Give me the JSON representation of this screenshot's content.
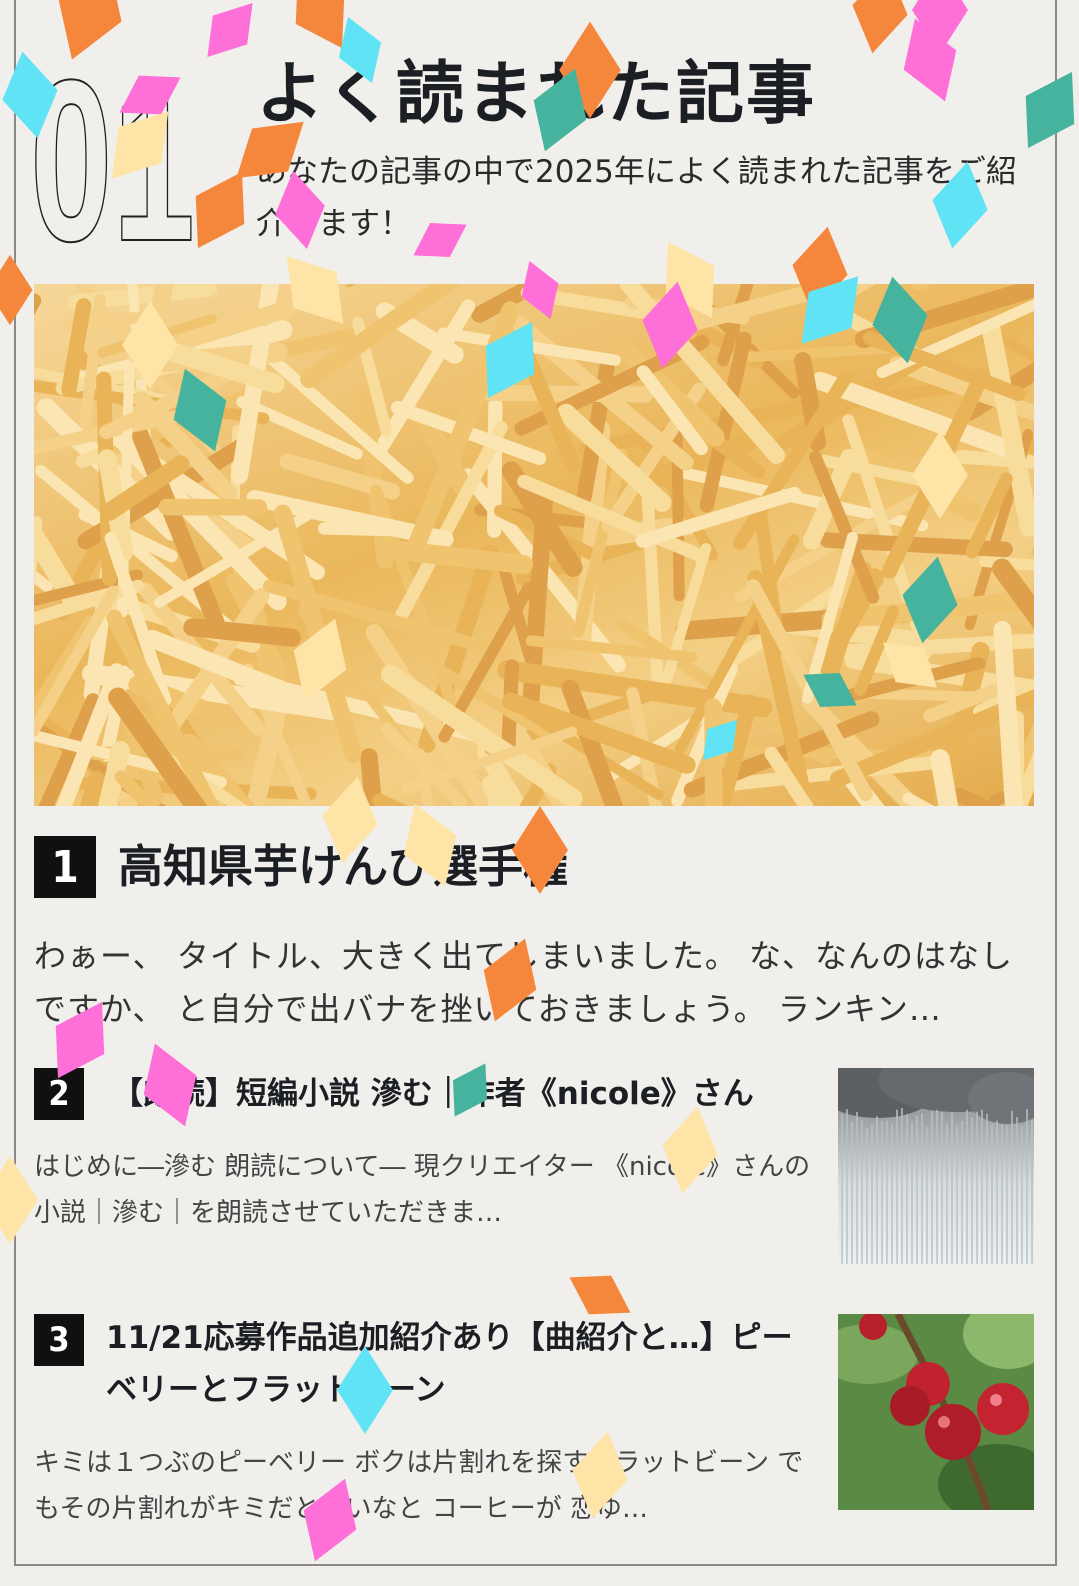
{
  "section": {
    "number": "01",
    "title": "よく読まれた記事",
    "subtitle": "あなたの記事の中で2025年によく読まれた記事をご紹介します！"
  },
  "articles": [
    {
      "rank": "1",
      "title": "高知県芋けんぴ選手権",
      "excerpt": "わぁー、 タイトル、大きく出てしまいました。 な、なんのはなしですか、 と自分で出バナを挫いておきましょう。 ランキン…"
    },
    {
      "rank": "2",
      "title": "【朗読】短編小説 滲む｜作者《nicole》さん",
      "excerpt": "はじめに―滲む 朗読について― 現クリエイター 《nicole》さんの小説｜滲む｜を朗読させていただきま…"
    },
    {
      "rank": "3",
      "title": "11/21応募作品追加紹介あり【曲紹介と…】ピーベリーとフラットビーン",
      "excerpt": "キミは１つぶのピーベリー ボクは片割れを探すフラットビーン でもその片割れがキミだといいなと コーヒーが 恋ゆ…"
    }
  ],
  "colors": {
    "background": "#f1efec",
    "badge": "#101010",
    "confetti": [
      "#f5873d",
      "#ff6fd8",
      "#5fe3f5",
      "#45b39d",
      "#ffe4a8"
    ]
  }
}
